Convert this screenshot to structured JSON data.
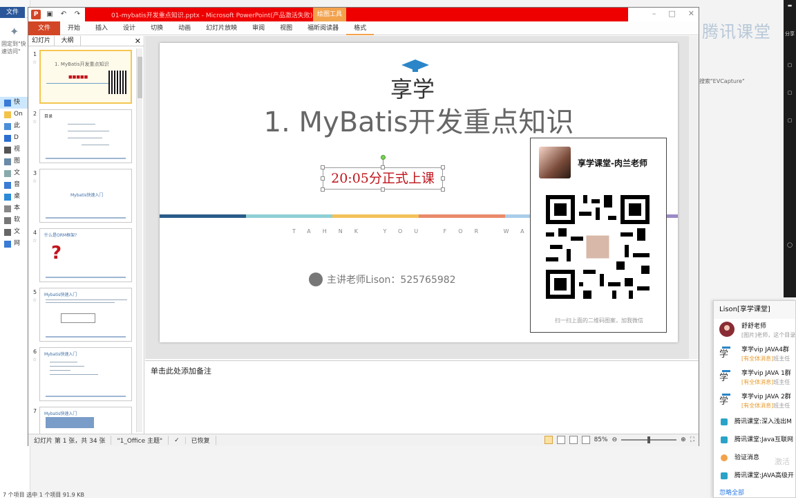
{
  "explorer": {
    "file_tab": "文件",
    "pin_hint": "固定到\"快速访问\"",
    "nav_items": [
      "快",
      "On",
      "此",
      "D",
      "视",
      "图",
      "文",
      "音",
      "桌",
      "本",
      "软",
      "文",
      "网"
    ],
    "status": "7 个项目    选中 1 个项目  91.9 KB"
  },
  "ppt": {
    "context_tab_top": "绘图工具",
    "title": "01-mybatis开发重点知识.pptx  -  Microsoft PowerPoint(产品激活失败)",
    "ribbon_tabs": [
      "文件",
      "开始",
      "插入",
      "设计",
      "切换",
      "动画",
      "幻灯片放映",
      "审阅",
      "视图",
      "福昕阅读器",
      "格式"
    ],
    "panel_tabs": [
      "幻灯片",
      "大纲"
    ],
    "thumbnails": [
      {
        "num": "1",
        "text": "1. MyBatis开发重点知识"
      },
      {
        "num": "2",
        "text": "目录"
      },
      {
        "num": "3",
        "text": "Mybatis快速入门"
      },
      {
        "num": "4",
        "text": "什么是ORM框架?"
      },
      {
        "num": "5",
        "text": "Mybatis快速入门"
      },
      {
        "num": "6",
        "text": "Mybatis快速入门"
      },
      {
        "num": "7",
        "text": "Mybatis快速入门"
      }
    ],
    "slide": {
      "logo_text": "享学",
      "title": "1. MyBatis开发重点知识",
      "time_text": "20:05分正式上课",
      "thanks": "TAHNK YOU FOR WATCHING",
      "teacher": "主讲老师Lison：525765982"
    },
    "qr_card": {
      "name": "享学课堂-肉兰老师",
      "caption": "扫一扫上面的二维码图案，加我微信"
    },
    "notes_placeholder": "单击此处添加备注",
    "status": {
      "slide_info": "幻灯片 第 1 张，共 34 张",
      "theme": "\"1_Office 主题\"",
      "restore": "已恢复",
      "zoom": "85%"
    }
  },
  "tencent": {
    "brand": "腾讯课堂",
    "search_hint": "搜索\"EVCapture\""
  },
  "darkstrip": {
    "share": "分享"
  },
  "chat": {
    "title": "Lison[享学课堂]",
    "items": [
      {
        "name": "舒舒老师",
        "sub_tag": "",
        "sub": "[图片]老师，这个目录"
      },
      {
        "name": "享学vip JAVA4群",
        "sub_tag": "[有全体消息]",
        "sub": "班主任"
      },
      {
        "name": "享学vip JAVA 1群",
        "sub_tag": "[有全体消息]",
        "sub": "班主任"
      },
      {
        "name": "享学vip JAVA 2群",
        "sub_tag": "[有全体消息]",
        "sub": "班主任"
      }
    ],
    "rows": [
      "腾讯课堂:深入浅出M",
      "腾讯课堂:Java互联网",
      "验证消息",
      "腾讯课堂:JAVA高级开"
    ],
    "more": "忽略全部",
    "watermark": "激活"
  },
  "colors": {
    "ppt_red": "#d24625",
    "title_red": "#ee0000",
    "time_red": "#c0141c",
    "stripe": [
      "#2b5c8a",
      "#8fcfd4",
      "#f3c15a",
      "#e98a6a",
      "#a9cdea",
      "#9a8ac8"
    ]
  }
}
